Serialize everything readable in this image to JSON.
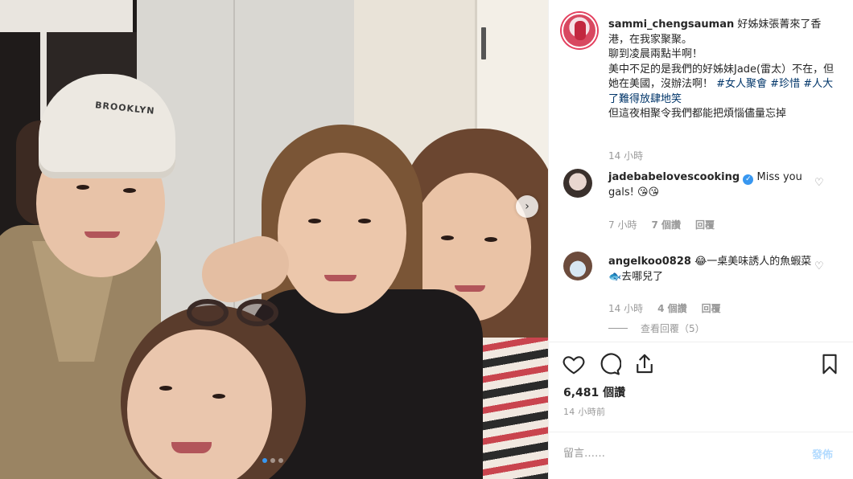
{
  "post": {
    "cap_text": "BROOKLYN",
    "username": "sammi_chengsauman",
    "caption_line1": " 好姊妹張菁來了香港，在我家聚聚。",
    "caption_line2": "聊到凌晨兩點半啊！",
    "caption_line3": "美中不足的是我們的好姊妹Jade(雷太）不在，但她在美國，沒辦法啊！",
    "hashtags": "#女人聚會 #珍惜 #人大了難得放肆地笑",
    "caption_line4": "但這夜相聚令我們都能把煩惱儘量忘掉",
    "time": "14 小時"
  },
  "comments": [
    {
      "username": "jadebabelovescooking",
      "verified": true,
      "text": "Miss you gals! 😘😘",
      "time": "7 小時",
      "likes": "7 個讚",
      "reply": "回覆"
    },
    {
      "username": "angelkoo0828",
      "verified": false,
      "text": "😂一桌美味誘人的魚蝦菜🐟去哪兒了",
      "time": "14 小時",
      "likes": "4 個讚",
      "reply": "回覆",
      "view_replies": "查看回覆（5）"
    }
  ],
  "stats": {
    "likes": "6,481 個讚",
    "posted": "14 小時前"
  },
  "composer": {
    "placeholder": "留言……",
    "post_label": "發佈"
  },
  "carousel": {
    "next_symbol": "›"
  },
  "icons": [
    "heart-icon",
    "comment-icon",
    "share-icon",
    "bookmark-icon",
    "chevron-right-icon",
    "verified-badge-icon"
  ],
  "colors": {
    "link": "#003569",
    "verified": "#3897f0",
    "story_ring": "#e4405f",
    "post_disabled": "#b3dbff",
    "meta_gray": "#999999"
  }
}
